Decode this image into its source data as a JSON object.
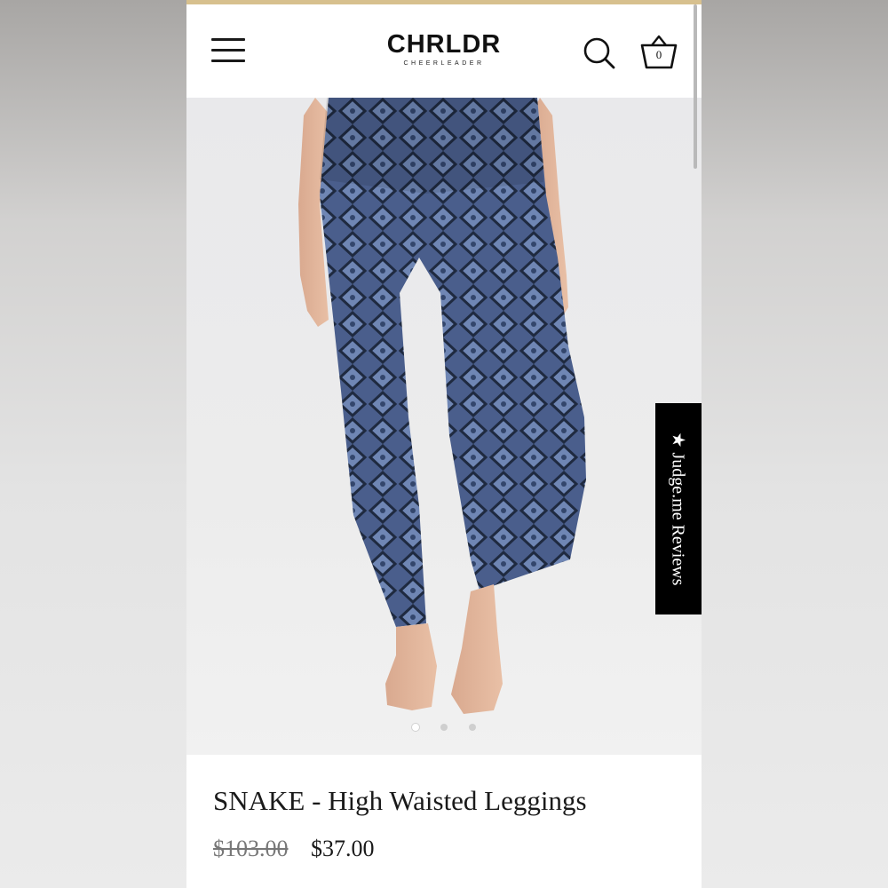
{
  "header": {
    "logo_main": "CHRLDR",
    "logo_sub": "CHEERLEADER",
    "cart_count": "0"
  },
  "icons": {
    "menu": "hamburger-menu-icon",
    "search": "search-icon",
    "cart": "basket-icon",
    "star": "star-icon"
  },
  "product": {
    "title": "SNAKE - High Waisted Leggings",
    "price_original": "$103.00",
    "price_sale": "$37.00"
  },
  "reviews_tab": {
    "star": "★",
    "label": "Judge.me Reviews"
  },
  "gallery": {
    "slide_count": 3,
    "active_index": 0
  },
  "colors": {
    "accent_bar": "#d7c08e",
    "leggings": "#3e4f78",
    "reviews_tab_bg": "#000000"
  }
}
